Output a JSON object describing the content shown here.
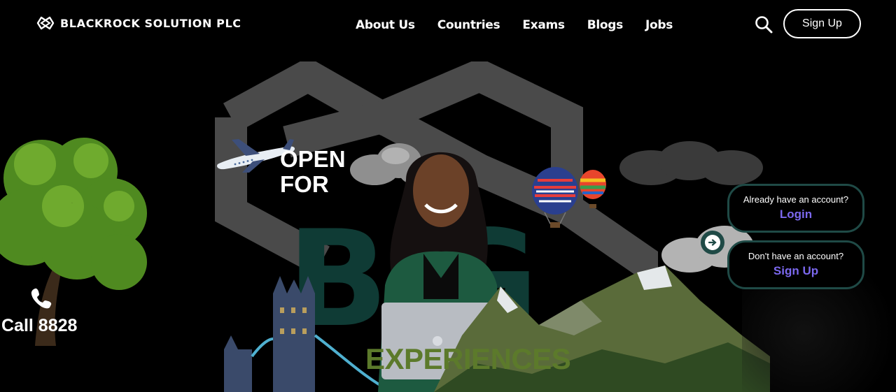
{
  "header": {
    "brand": "BLACKROCK SOLUTION PLC",
    "nav": [
      "About Us",
      "Countries",
      "Exams",
      "Blogs",
      "Jobs"
    ],
    "signup_label": "Sign Up"
  },
  "hero": {
    "open_line1": "OPEN",
    "open_line2": "FOR",
    "big_word": "BIG",
    "experiences": "EXPERIENCES",
    "call_label": "Call 8828"
  },
  "account": {
    "login_hint": "Already have an account?",
    "login_label": "Login",
    "signup_hint": "Don't have an account?",
    "signup_label": "Sign Up"
  },
  "icons": {
    "logo": "logo-icon",
    "search": "search-icon",
    "phone": "phone-icon",
    "arrow": "arrow-right-icon"
  },
  "colors": {
    "background": "#000000",
    "accent_link": "#7b68ee",
    "card_border": "#1f4a46",
    "big_text": "#0f3b35",
    "experiences": "#5c7a2b"
  }
}
